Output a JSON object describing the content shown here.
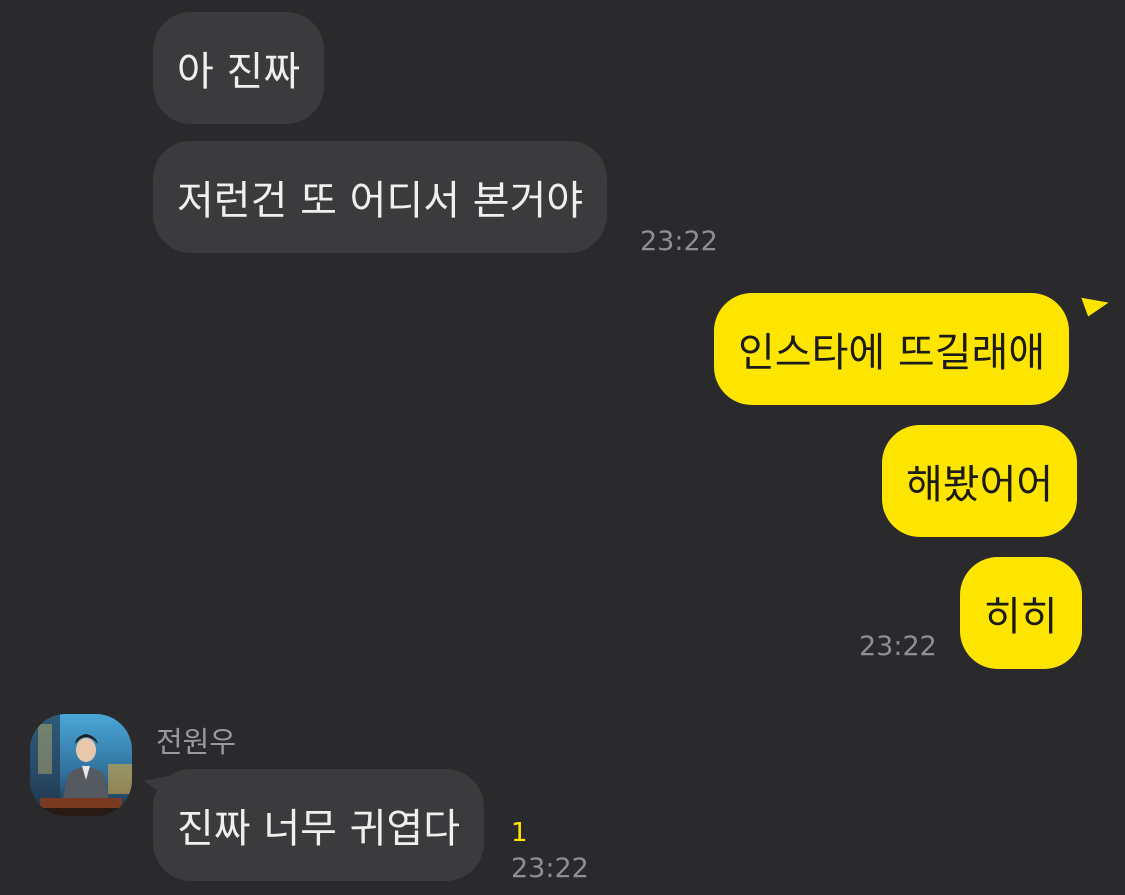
{
  "messages": [
    {
      "direction": "in",
      "text": "아 진짜"
    },
    {
      "direction": "in",
      "text": "저런건 또 어디서 본거야",
      "time": "23:22"
    },
    {
      "direction": "out",
      "text": "인스타에 뜨길래애"
    },
    {
      "direction": "out",
      "text": "해봤어어"
    },
    {
      "direction": "out",
      "text": "히히",
      "time": "23:22"
    },
    {
      "direction": "in",
      "sender": "전원우",
      "text": "진짜 너무 귀엽다",
      "unread": "1",
      "time": "23:22"
    }
  ],
  "colors": {
    "background": "#2a2a2c",
    "incoming_bubble": "#3b3b3d",
    "outgoing_bubble": "#fee500",
    "timestamp": "#8f8f93",
    "unread_badge": "#fee500"
  },
  "icons": {
    "avatar": "profile-photo-avatar"
  }
}
